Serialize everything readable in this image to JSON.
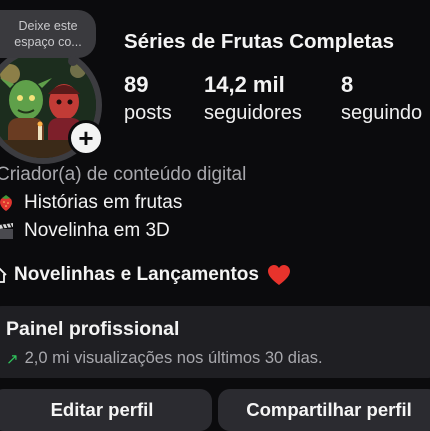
{
  "note": {
    "line1": "Deixe este",
    "line2": "espaço co..."
  },
  "profile": {
    "name": "Séries de Frutas Completas",
    "avatar_alt": "avatar"
  },
  "stats": [
    {
      "value": "89",
      "label": "posts"
    },
    {
      "value": "14,2 mil",
      "label": "seguidores"
    },
    {
      "value": "8",
      "label": "seguindo"
    }
  ],
  "bio": {
    "category": "Criador(a) de conteúdo digital",
    "lines": [
      {
        "icon": "strawberry-icon",
        "text": "Histórias em frutas"
      },
      {
        "icon": "clapperboard-icon",
        "text": "Novelinha em 3D"
      }
    ],
    "highlight": {
      "icon": "house-icon",
      "text": "Novelinhas e Lançamentos",
      "end_icon": "red-heart-icon"
    }
  },
  "panel": {
    "title": "Painel profissional",
    "subtitle": "2,0 mi visualizações nos últimos 30 dias.",
    "trend_icon": "trend-up-icon",
    "trend_color": "#2fc45c"
  },
  "buttons": {
    "edit": "Editar perfil",
    "share": "Compartilhar perfil"
  },
  "colors": {
    "background": "#0b0b0d",
    "panel": "#1f1f23",
    "button": "#2b2b30",
    "muted_text": "#a8a8ad"
  }
}
